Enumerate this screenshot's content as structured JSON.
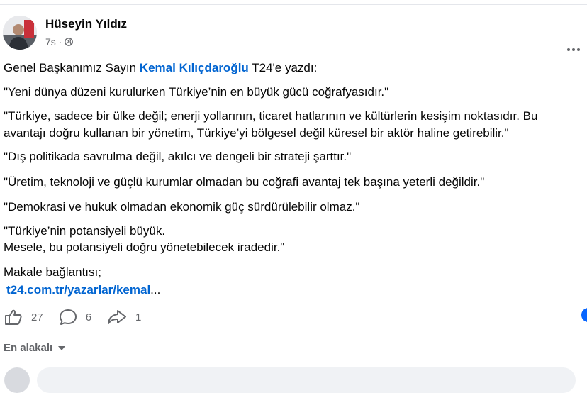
{
  "post": {
    "author": "Hüseyin Yıldız",
    "time": "7s",
    "dot": "·",
    "intro": {
      "before": "Genel Başkanımız Sayın ",
      "mention": "Kemal Kılıçdaroğlu",
      "after": "  T24'e yazdı:"
    },
    "paragraphs": [
      "\"Yeni dünya düzeni kurulurken Türkiye’nin en büyük gücü coğrafyasıdır.\"",
      "\"Türkiye, sadece bir ülke değil; enerji yollarının, ticaret hatlarının ve kültürlerin kesişim noktasıdır. Bu",
      "avantajı doğru kullanan bir yönetim, Türkiye’yi bölgesel değil küresel bir aktör haline getirebilir.\"",
      "\"Dış politikada savrulma değil, akılcı ve dengeli bir strateji şarttır.\"",
      "\"Üretim, teknoloji ve güçlü kurumlar olmadan bu coğrafi avantaj tek başına yeterli değildir.\"",
      "\"Demokrasi ve hukuk olmadan ekonomik güç sürdürülebilir olmaz.\"",
      "\"Türkiye’nin potansiyeli büyük.",
      "Mesele, bu potansiyeli doğru yönetebilecek iradedir.\"",
      "Makale bağlantısı;"
    ],
    "link_text": "t24.com.tr/yazarlar/kemal",
    "link_ellipsis": "..."
  },
  "actions": {
    "likes": "27",
    "comments": "6",
    "shares": "1"
  },
  "comments_sort": {
    "label": "En alakalı"
  },
  "icons": {
    "globe": "globe-icon",
    "like": "like-icon",
    "comment": "comment-icon",
    "share": "share-icon",
    "more": "more-icon"
  },
  "colors": {
    "link": "#0064d1",
    "muted": "#65676b",
    "accent": "#0866ff"
  }
}
